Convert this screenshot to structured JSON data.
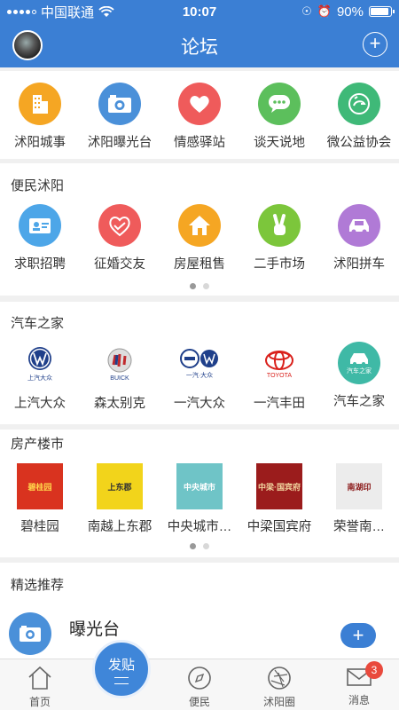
{
  "status": {
    "carrier": "中国联通",
    "time": "10:07",
    "battery": "90%",
    "battery_level": 0.9
  },
  "nav": {
    "title": "论坛",
    "add_label": "+"
  },
  "top_grid": [
    {
      "label": "沭阳城事",
      "icon": "building-icon",
      "color": "#f5a623"
    },
    {
      "label": "沭阳曝光台",
      "icon": "camera-icon",
      "color": "#4a90d9"
    },
    {
      "label": "情感驿站",
      "icon": "heart-icon",
      "color": "#ef5b5b"
    },
    {
      "label": "谈天说地",
      "icon": "chat-icon",
      "color": "#5cbf5c"
    },
    {
      "label": "微公益协会",
      "icon": "charity-icon",
      "color": "#3fb978"
    }
  ],
  "bianmin": {
    "title": "便民沭阳",
    "items": [
      {
        "label": "求职招聘",
        "icon": "id-card-icon",
        "color": "#4da6e8"
      },
      {
        "label": "征婚交友",
        "icon": "handshake-heart-icon",
        "color": "#ef5b5b"
      },
      {
        "label": "房屋租售",
        "icon": "house-icon",
        "color": "#f5a623"
      },
      {
        "label": "二手市场",
        "icon": "victory-hand-icon",
        "color": "#7cc63b"
      },
      {
        "label": "沭阳拼车",
        "icon": "car-icon",
        "color": "#b07ad6"
      }
    ]
  },
  "qiche": {
    "title": "汽车之家",
    "items": [
      {
        "label": "上汽大众",
        "icon": "vw-logo-icon",
        "sub": "上汽大众"
      },
      {
        "label": "森太别克",
        "icon": "buick-logo-icon",
        "sub": "BUICK"
      },
      {
        "label": "一汽大众",
        "icon": "faw-vw-logo-icon",
        "sub": "一汽·大众"
      },
      {
        "label": "一汽丰田",
        "icon": "toyota-logo-icon",
        "sub": "TOYOTA"
      },
      {
        "label": "汽车之家",
        "icon": "car-home-icon",
        "sub": "汽车之家"
      }
    ]
  },
  "fangchan": {
    "title": "房产楼市",
    "items": [
      {
        "label": "碧桂园",
        "icon": "biguiyuan-logo-icon",
        "sub": "碧桂园",
        "bg": "#d9331f",
        "fg": "#ffd24a"
      },
      {
        "label": "南越上东郡",
        "icon": "nanyue-logo-icon",
        "sub": "上东郡",
        "bg": "#f2d41b",
        "fg": "#333333"
      },
      {
        "label": "中央城市…",
        "icon": "zhongyang-logo-icon",
        "sub": "中央城市",
        "bg": "#6fc4c7",
        "fg": "#ffffff"
      },
      {
        "label": "中梁国宾府",
        "icon": "zhongliang-logo-icon",
        "sub": "中梁·国宾府",
        "bg": "#9b1c1c",
        "fg": "#f2d6a0"
      },
      {
        "label": "荣誉南…",
        "icon": "rongyu-logo-icon",
        "sub": "南湖印",
        "bg": "#ececec",
        "fg": "#8b1a1a"
      }
    ]
  },
  "jingxuan": {
    "title": "精选推荐",
    "first_item": "曝光台"
  },
  "tabs": [
    {
      "label": "首页",
      "icon": "home-icon"
    },
    {
      "label": "发贴",
      "icon": "post-icon"
    },
    {
      "label": "便民",
      "icon": "compass-icon"
    },
    {
      "label": "沭阳圈",
      "icon": "aperture-icon"
    },
    {
      "label": "消息",
      "icon": "mail-icon",
      "badge": "3"
    }
  ],
  "fab_label": "+",
  "colors": {
    "primary": "#3b7fd4",
    "badge": "#e94a3d"
  }
}
